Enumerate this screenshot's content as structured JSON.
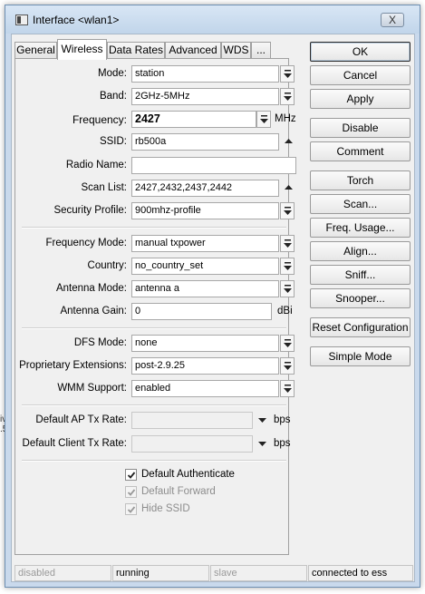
{
  "window": {
    "title": "Interface <wlan1>",
    "close_glyph": "X"
  },
  "tabs": [
    {
      "label": "General",
      "active": false
    },
    {
      "label": "Wireless",
      "active": true
    },
    {
      "label": "Data Rates",
      "active": false
    },
    {
      "label": "Advanced",
      "active": false
    },
    {
      "label": "WDS",
      "active": false
    },
    {
      "label": "...",
      "active": false
    }
  ],
  "fields": {
    "mode": {
      "label": "Mode:",
      "value": "station"
    },
    "band": {
      "label": "Band:",
      "value": "2GHz-5MHz"
    },
    "frequency": {
      "label": "Frequency:",
      "value": "2427",
      "unit": "MHz"
    },
    "ssid": {
      "label": "SSID:",
      "value": "rb500a"
    },
    "radio_name": {
      "label": "Radio Name:",
      "value": ""
    },
    "scan_list": {
      "label": "Scan List:",
      "value": "2427,2432,2437,2442"
    },
    "security_profile": {
      "label": "Security Profile:",
      "value": "900mhz-profile"
    },
    "frequency_mode": {
      "label": "Frequency Mode:",
      "value": "manual txpower"
    },
    "country": {
      "label": "Country:",
      "value": "no_country_set"
    },
    "antenna_mode": {
      "label": "Antenna Mode:",
      "value": "antenna a"
    },
    "antenna_gain": {
      "label": "Antenna Gain:",
      "value": "0",
      "unit": "dBi"
    },
    "dfs_mode": {
      "label": "DFS Mode:",
      "value": "none"
    },
    "proprietary_extensions": {
      "label": "Proprietary Extensions:",
      "value": "post-2.9.25"
    },
    "wmm_support": {
      "label": "WMM Support:",
      "value": "enabled"
    },
    "default_ap_tx_rate": {
      "label": "Default AP Tx Rate:",
      "value": "",
      "unit": "bps"
    },
    "default_client_tx_rate": {
      "label": "Default Client Tx Rate:",
      "value": "",
      "unit": "bps"
    }
  },
  "checkboxes": {
    "default_authenticate": {
      "label": "Default Authenticate",
      "checked": true,
      "enabled": true
    },
    "default_forward": {
      "label": "Default Forward",
      "checked": true,
      "enabled": false
    },
    "hide_ssid": {
      "label": "Hide SSID",
      "checked": true,
      "enabled": false
    }
  },
  "buttons": {
    "ok": "OK",
    "cancel": "Cancel",
    "apply": "Apply",
    "disable": "Disable",
    "comment": "Comment",
    "torch": "Torch",
    "scan": "Scan...",
    "freq_usage": "Freq. Usage...",
    "align": "Align...",
    "sniff": "Sniff...",
    "snooper": "Snooper...",
    "reset_configuration": "Reset Configuration",
    "simple_mode": "Simple Mode"
  },
  "status_bar": [
    "disabled",
    "running",
    "slave",
    "connected to ess"
  ],
  "background_fragment": [
    "iv",
    ".5"
  ]
}
